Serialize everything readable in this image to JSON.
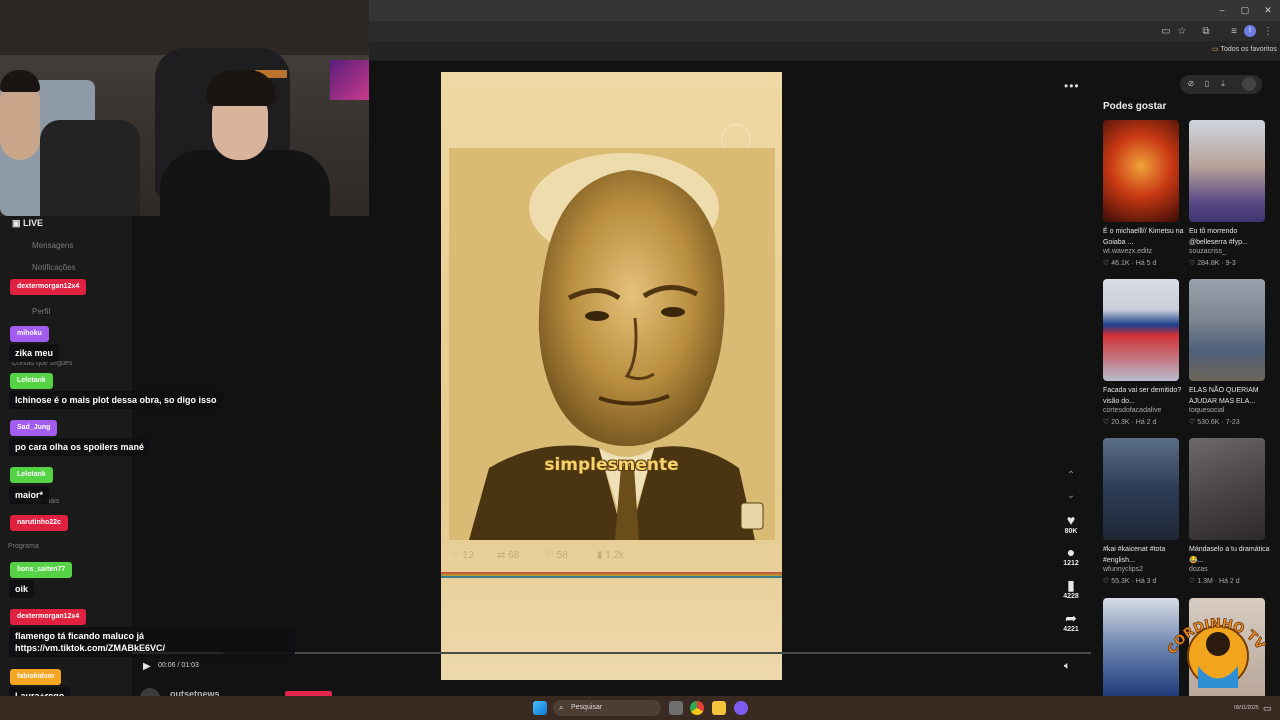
{
  "browser": {
    "window_controls": [
      "–",
      "▢",
      "✕"
    ],
    "bookmarks_label": "Todos os favoritos",
    "profile_initial": "I"
  },
  "stream_overlay": {
    "live_label": "LIVE",
    "sidebar_ghost": [
      {
        "text": "Mensagens"
      },
      {
        "text": "Notificações"
      },
      {
        "text": "Perfil"
      },
      {
        "text": "Contas que segues"
      },
      {
        "text": "Ver mais"
      },
      {
        "text": "Programa"
      }
    ]
  },
  "chat": [
    {
      "user": "dextermorgan12x4",
      "color": "#e0213f",
      "text": ""
    },
    {
      "user": "mihoku",
      "color": "#a35cf0",
      "text": "zika meu"
    },
    {
      "user": "Lelotank",
      "color": "#55d246",
      "text": "Ichinose é o mais plot dessa obra, so digo isso"
    },
    {
      "user": "Sad_Jung",
      "color": "#a35cf0",
      "text": "po cara olha os spoilers mané"
    },
    {
      "user": "Lelotank",
      "color": "#55d246",
      "text": "maior*"
    },
    {
      "user": "narutinho22c",
      "color": "#e0213f",
      "text": ""
    },
    {
      "user": "lions_saiten77",
      "color": "#55d246",
      "text": "oik"
    },
    {
      "user": "dextermorgan12x4",
      "color": "#e0213f",
      "text": "flamengo tá ficando maluco já\nhttps://vm.tiktok.com/ZMABkE6VC/"
    },
    {
      "user": "fabiokidsm",
      "color": "#f5a623",
      "text": "Laura+rego"
    }
  ],
  "video": {
    "caption": "simplesmente",
    "inner_stats": {
      "replies": "12",
      "reposts": "68",
      "likes": "58",
      "views": "1,2k"
    },
    "time": "00:06 / 01:03",
    "progress": 0.095,
    "author": "outsetnews"
  },
  "actions": {
    "likes": "80K",
    "comments": "1212",
    "saves": "4228",
    "shares": "4221"
  },
  "recommendations": {
    "title": "Podes gostar",
    "items": [
      {
        "title": "É o michaelll// Kimetsu na Goiaba ...",
        "user": "wt.wavezx.editz",
        "views": "46.1K",
        "age": "Há 5 d"
      },
      {
        "title": "Eu tô morrendo @belleserra #fyp...",
        "user": "souzacriss_",
        "views": "284.8K",
        "age": "9-3"
      },
      {
        "title": "Facada vai ser demitido? visão do...",
        "user": "cortesdofacadalive",
        "views": "20.3K",
        "age": "Há 2 d"
      },
      {
        "title": "ELAS NÃO QUERIAM AJUDAR MAS ELA...",
        "user": "toquesocial",
        "views": "530.6K",
        "age": "7-23"
      },
      {
        "title": "#kai #kaicenat #tota #english...",
        "user": "wfunnyclips2",
        "views": "55.3K",
        "age": "Há 3 d"
      },
      {
        "title": "Mándaselo a tu dramática 😂...",
        "user": "dozas",
        "views": "1.3M",
        "age": "Há 2 d"
      }
    ]
  },
  "taskbar": {
    "search_placeholder": "Pesquisar",
    "date": "09/11/2025"
  },
  "watermark": {
    "text": "CORDINHO TV"
  }
}
